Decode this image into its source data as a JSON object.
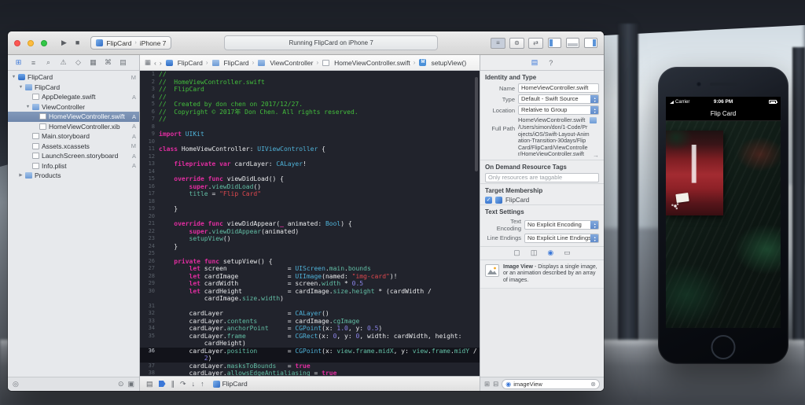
{
  "colors": {
    "accent": "#3B78D8",
    "code_bg": "#21232C",
    "comment": "#43BE3C",
    "keyword": "#E12DA0",
    "type": "#4FB2D8",
    "member": "#62BDA4",
    "string": "#E0484E",
    "number": "#8B84E8",
    "plain": "#E8E9EB"
  },
  "toolbar": {
    "scheme": "FlipCard",
    "device": "iPhone 7",
    "status": "Running FlipCard on iPhone 7",
    "crumb_separator": "›"
  },
  "navigator": {
    "toolbar_icons": [
      {
        "name": "project-navigator-icon",
        "glyph": "⊞"
      },
      {
        "name": "symbol-navigator-icon",
        "glyph": "≡"
      },
      {
        "name": "find-navigator-icon",
        "glyph": "⌕"
      },
      {
        "name": "issue-navigator-icon",
        "glyph": "⚠"
      },
      {
        "name": "test-navigator-icon",
        "glyph": "◇"
      },
      {
        "name": "debug-navigator-icon",
        "glyph": "▦"
      },
      {
        "name": "breakpoint-navigator-icon",
        "glyph": "⌘"
      },
      {
        "name": "report-navigator-icon",
        "glyph": "▤"
      }
    ],
    "disclosure_open": "▼",
    "disclosure_closed": "▶",
    "items": [
      {
        "label": "FlipCard",
        "type": "project",
        "indent": 0,
        "disc": "open",
        "badge": "M",
        "selected": false
      },
      {
        "label": "FlipCard",
        "type": "folder",
        "indent": 1,
        "disc": "open",
        "badge": "",
        "selected": false
      },
      {
        "label": "AppDelegate.swift",
        "type": "file",
        "indent": 2,
        "disc": "",
        "badge": "A",
        "selected": false
      },
      {
        "label": "ViewController",
        "type": "folder",
        "indent": 2,
        "disc": "open",
        "badge": "",
        "selected": false
      },
      {
        "label": "HomeViewController.swift",
        "type": "file",
        "indent": 3,
        "disc": "",
        "badge": "A",
        "selected": true
      },
      {
        "label": "HomeViewController.xib",
        "type": "file",
        "indent": 3,
        "disc": "",
        "badge": "A",
        "selected": false
      },
      {
        "label": "Main.storyboard",
        "type": "file",
        "indent": 2,
        "disc": "",
        "badge": "A",
        "selected": false
      },
      {
        "label": "Assets.xcassets",
        "type": "assets",
        "indent": 2,
        "disc": "",
        "badge": "M",
        "selected": false
      },
      {
        "label": "LaunchScreen.storyboard",
        "type": "file",
        "indent": 2,
        "disc": "",
        "badge": "A",
        "selected": false
      },
      {
        "label": "Info.plist",
        "type": "file",
        "indent": 2,
        "disc": "",
        "badge": "A",
        "selected": false
      },
      {
        "label": "Products",
        "type": "folder",
        "indent": 1,
        "disc": "closed",
        "badge": "",
        "selected": false
      }
    ]
  },
  "jumpbar": {
    "crumbs": [
      {
        "label": "FlipCard",
        "icon": "project"
      },
      {
        "label": "FlipCard",
        "icon": "folder"
      },
      {
        "label": "ViewController",
        "icon": "folder"
      },
      {
        "label": "HomeViewController.swift",
        "icon": "file"
      },
      {
        "label": "setupView()",
        "icon": "method"
      }
    ]
  },
  "editor": {
    "lines": [
      {
        "n": "1",
        "t": [
          [
            "c",
            "//"
          ]
        ]
      },
      {
        "n": "2",
        "t": [
          [
            "c",
            "//  HomeViewController.swift"
          ]
        ]
      },
      {
        "n": "3",
        "t": [
          [
            "c",
            "//  FlipCard"
          ]
        ]
      },
      {
        "n": "4",
        "t": [
          [
            "c",
            "//"
          ]
        ]
      },
      {
        "n": "5",
        "t": [
          [
            "c",
            "//  Created by don chen on 2017/12/27."
          ]
        ]
      },
      {
        "n": "6",
        "t": [
          [
            "c",
            "//  Copyright © 2017年 Don Chen. All rights reserved."
          ]
        ]
      },
      {
        "n": "7",
        "t": [
          [
            "c",
            "//"
          ]
        ]
      },
      {
        "n": "8",
        "t": []
      },
      {
        "n": "9",
        "t": [
          [
            "k",
            "import"
          ],
          [
            "p",
            " "
          ],
          [
            "t",
            "UIKit"
          ]
        ]
      },
      {
        "n": "10",
        "t": []
      },
      {
        "n": "11",
        "t": [
          [
            "k",
            "class"
          ],
          [
            "p",
            " HomeViewController: "
          ],
          [
            "t",
            "UIViewController"
          ],
          [
            "p",
            " {"
          ]
        ]
      },
      {
        "n": "12",
        "t": []
      },
      {
        "n": "13",
        "t": [
          [
            "p",
            "    "
          ],
          [
            "k",
            "fileprivate"
          ],
          [
            "p",
            " "
          ],
          [
            "k",
            "var"
          ],
          [
            "p",
            " cardLayer: "
          ],
          [
            "t",
            "CALayer"
          ],
          [
            "p",
            "!"
          ]
        ]
      },
      {
        "n": "14",
        "t": []
      },
      {
        "n": "15",
        "t": [
          [
            "p",
            "    "
          ],
          [
            "k",
            "override"
          ],
          [
            "p",
            " "
          ],
          [
            "k",
            "func"
          ],
          [
            "p",
            " viewDidLoad() {"
          ]
        ]
      },
      {
        "n": "16",
        "t": [
          [
            "p",
            "        "
          ],
          [
            "k",
            "super"
          ],
          [
            "p",
            "."
          ],
          [
            "m",
            "viewDidLoad"
          ],
          [
            "p",
            "()"
          ]
        ]
      },
      {
        "n": "17",
        "t": [
          [
            "p",
            "        "
          ],
          [
            "m",
            "title"
          ],
          [
            "p",
            " = "
          ],
          [
            "s",
            "\"Flip Card\""
          ]
        ]
      },
      {
        "n": "18",
        "t": []
      },
      {
        "n": "19",
        "t": [
          [
            "p",
            "    }"
          ]
        ]
      },
      {
        "n": "20",
        "t": []
      },
      {
        "n": "21",
        "t": [
          [
            "p",
            "    "
          ],
          [
            "k",
            "override"
          ],
          [
            "p",
            " "
          ],
          [
            "k",
            "func"
          ],
          [
            "p",
            " viewDidAppear("
          ],
          [
            "k",
            "_"
          ],
          [
            "p",
            " animated: "
          ],
          [
            "t",
            "Bool"
          ],
          [
            "p",
            ") {"
          ]
        ]
      },
      {
        "n": "22",
        "t": [
          [
            "p",
            "        "
          ],
          [
            "k",
            "super"
          ],
          [
            "p",
            "."
          ],
          [
            "m",
            "viewDidAppear"
          ],
          [
            "p",
            "(animated)"
          ]
        ]
      },
      {
        "n": "23",
        "t": [
          [
            "p",
            "        "
          ],
          [
            "m",
            "setupView"
          ],
          [
            "p",
            "()"
          ]
        ]
      },
      {
        "n": "24",
        "t": [
          [
            "p",
            "    }"
          ]
        ]
      },
      {
        "n": "25",
        "t": []
      },
      {
        "n": "26",
        "t": [
          [
            "p",
            "    "
          ],
          [
            "k",
            "private"
          ],
          [
            "p",
            " "
          ],
          [
            "k",
            "func"
          ],
          [
            "p",
            " setupView() {"
          ]
        ]
      },
      {
        "n": "27",
        "t": [
          [
            "p",
            "        "
          ],
          [
            "k",
            "let"
          ],
          [
            "p",
            " screen                = "
          ],
          [
            "t",
            "UIScreen"
          ],
          [
            "p",
            "."
          ],
          [
            "m",
            "main"
          ],
          [
            "p",
            "."
          ],
          [
            "m",
            "bounds"
          ]
        ]
      },
      {
        "n": "28",
        "t": [
          [
            "p",
            "        "
          ],
          [
            "k",
            "let"
          ],
          [
            "p",
            " cardImage             = "
          ],
          [
            "t",
            "UIImage"
          ],
          [
            "p",
            "(named: "
          ],
          [
            "s",
            "\"img-card\""
          ],
          [
            "p",
            ")!"
          ]
        ]
      },
      {
        "n": "29",
        "t": [
          [
            "p",
            "        "
          ],
          [
            "k",
            "let"
          ],
          [
            "p",
            " cardWidth             = screen."
          ],
          [
            "m",
            "width"
          ],
          [
            "p",
            " * "
          ],
          [
            "num",
            "0.5"
          ]
        ]
      },
      {
        "n": "30",
        "t": [
          [
            "p",
            "        "
          ],
          [
            "k",
            "let"
          ],
          [
            "p",
            " cardHeight            = cardImage."
          ],
          [
            "m",
            "size"
          ],
          [
            "p",
            "."
          ],
          [
            "m",
            "height"
          ],
          [
            "p",
            " * (cardWidth /"
          ]
        ]
      },
      {
        "n": "",
        "t": [
          [
            "p",
            "            cardImage."
          ],
          [
            "m",
            "size"
          ],
          [
            "p",
            "."
          ],
          [
            "m",
            "width"
          ],
          [
            "p",
            ")"
          ]
        ]
      },
      {
        "n": "31",
        "t": []
      },
      {
        "n": "32",
        "t": [
          [
            "p",
            "        cardLayer                 = "
          ],
          [
            "t",
            "CALayer"
          ],
          [
            "p",
            "()"
          ]
        ]
      },
      {
        "n": "33",
        "t": [
          [
            "p",
            "        cardLayer."
          ],
          [
            "m",
            "contents"
          ],
          [
            "p",
            "        = cardImage."
          ],
          [
            "m",
            "cgImage"
          ]
        ]
      },
      {
        "n": "34",
        "t": [
          [
            "p",
            "        cardLayer."
          ],
          [
            "m",
            "anchorPoint"
          ],
          [
            "p",
            "     = "
          ],
          [
            "t",
            "CGPoint"
          ],
          [
            "p",
            "(x: "
          ],
          [
            "num",
            "1.0"
          ],
          [
            "p",
            ", y: "
          ],
          [
            "num",
            "0.5"
          ],
          [
            "p",
            ")"
          ]
        ]
      },
      {
        "n": "35",
        "t": [
          [
            "p",
            "        cardLayer."
          ],
          [
            "m",
            "frame"
          ],
          [
            "p",
            "           = "
          ],
          [
            "t",
            "CGRect"
          ],
          [
            "p",
            "(x: "
          ],
          [
            "num",
            "0"
          ],
          [
            "p",
            ", y: "
          ],
          [
            "num",
            "0"
          ],
          [
            "p",
            ", width: cardWidth, height:"
          ]
        ]
      },
      {
        "n": "",
        "t": [
          [
            "p",
            "            cardHeight)"
          ]
        ]
      },
      {
        "n": "36",
        "h": true,
        "t": [
          [
            "p",
            "        cardLayer."
          ],
          [
            "m",
            "position"
          ],
          [
            "p",
            "        = "
          ],
          [
            "t",
            "CGPoint"
          ],
          [
            "p",
            "(x: "
          ],
          [
            "m",
            "view"
          ],
          [
            "p",
            "."
          ],
          [
            "m",
            "frame"
          ],
          [
            "p",
            "."
          ],
          [
            "m",
            "midX"
          ],
          [
            "p",
            ", y: "
          ],
          [
            "m",
            "view"
          ],
          [
            "p",
            "."
          ],
          [
            "m",
            "frame"
          ],
          [
            "p",
            "."
          ],
          [
            "m",
            "midY"
          ],
          [
            "p",
            " /"
          ]
        ]
      },
      {
        "n": "",
        "h": true,
        "t": [
          [
            "p",
            "            "
          ],
          [
            "num",
            "2"
          ],
          [
            "p",
            ")"
          ]
        ]
      },
      {
        "n": "37",
        "t": [
          [
            "p",
            "        cardLayer."
          ],
          [
            "m",
            "masksToBounds"
          ],
          [
            "p",
            "   = "
          ],
          [
            "k",
            "true"
          ]
        ]
      },
      {
        "n": "38",
        "t": [
          [
            "p",
            "        cardLayer."
          ],
          [
            "m",
            "allowsEdgeAntialiasing"
          ],
          [
            "p",
            " = "
          ],
          [
            "k",
            "true"
          ]
        ]
      }
    ]
  },
  "debugbar": {
    "app_label": "FlipCard"
  },
  "inspector": {
    "identity_header": "Identity and Type",
    "name_label": "Name",
    "name_value": "HomeViewController.swift",
    "type_label": "Type",
    "type_value": "Default - Swift Source",
    "location_label": "Location",
    "location_value": "Relative to Group",
    "location_file": "HomeViewController.swift",
    "fullpath_label": "Full Path",
    "fullpath_value": "/Users/simon/don/1-Code/Projects/iOS/Swift-Layout-Animation-Transition-30days/FlipCard/FlipCard/ViewController/HomeViewController.swift",
    "odr_header": "On Demand Resource Tags",
    "odr_placeholder": "Only resources are taggable",
    "target_header": "Target Membership",
    "target_item": "FlipCard",
    "text_header": "Text Settings",
    "encoding_label": "Text Encoding",
    "encoding_value": "No Explicit Encoding",
    "lineendings_label": "Line Endings",
    "lineendings_value": "No Explicit Line Endings",
    "library_tabs": [
      {
        "name": "file-template-library-icon",
        "glyph": "▢",
        "selected": false
      },
      {
        "name": "snippet-library-icon",
        "glyph": "◫",
        "selected": false
      },
      {
        "name": "object-library-icon",
        "glyph": "◉",
        "selected": true
      },
      {
        "name": "media-library-icon",
        "glyph": "▭",
        "selected": false
      }
    ],
    "library_entry_title": "Image View",
    "library_entry_desc": " - Displays a single image, or an animation described by an array of images.",
    "filter_value": "imageView"
  },
  "simulator": {
    "carrier": "Carrier",
    "time": "9:06 PM",
    "nav_title": "Flip Card"
  }
}
